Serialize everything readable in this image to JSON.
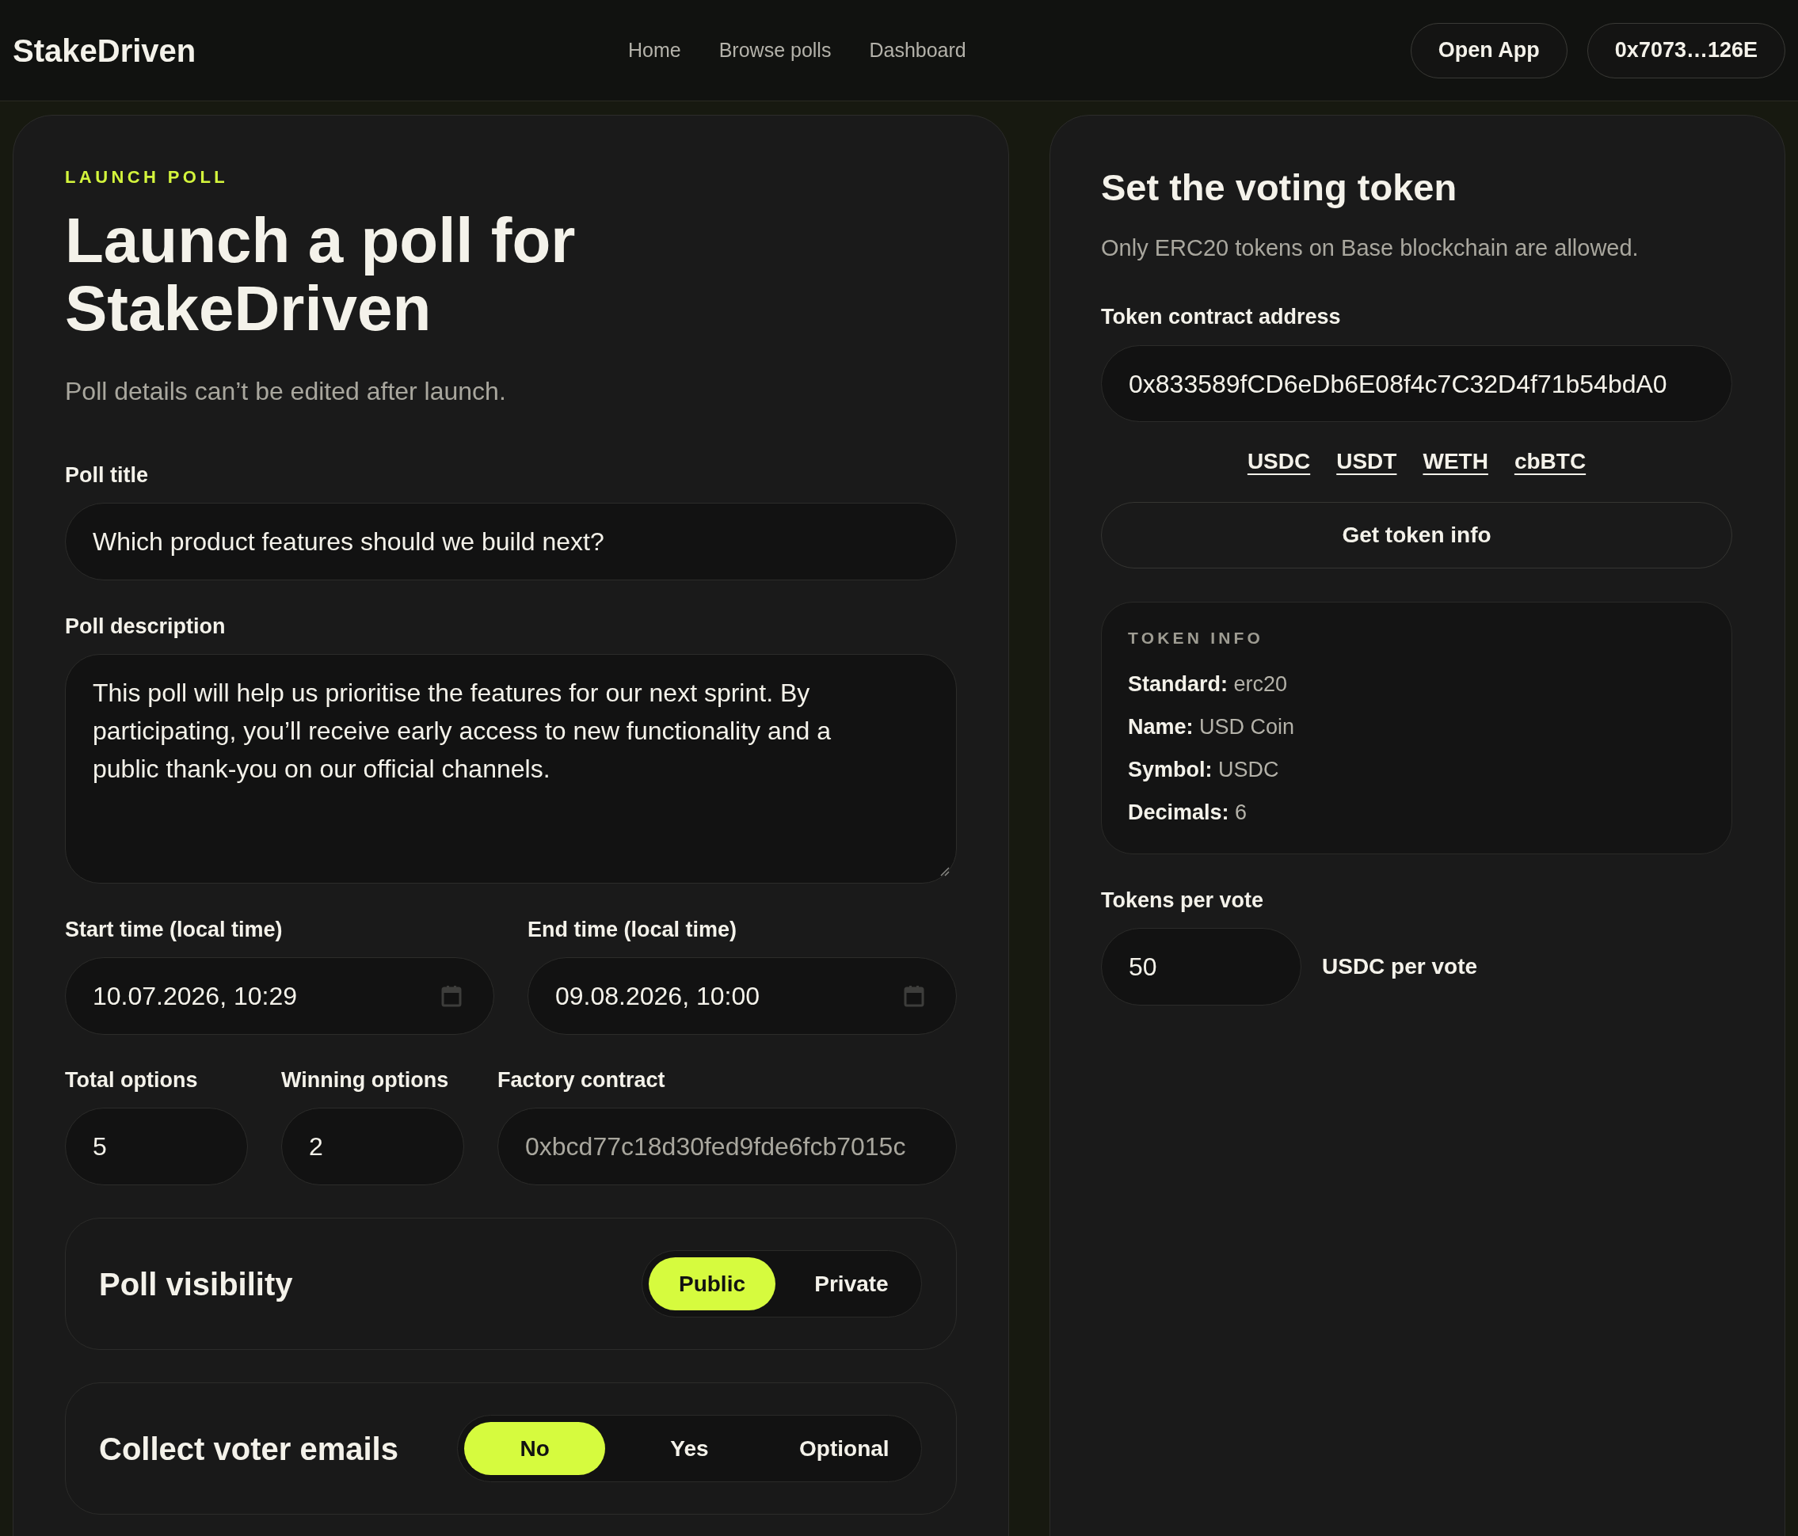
{
  "header": {
    "logo": "StakeDriven",
    "nav": [
      {
        "label": "Home"
      },
      {
        "label": "Browse polls"
      },
      {
        "label": "Dashboard"
      }
    ],
    "actions": [
      {
        "label": "Open App"
      },
      {
        "label": "0x7073…126E"
      }
    ]
  },
  "launch_form": {
    "eyebrow": "LAUNCH POLL",
    "title": "Launch a poll for StakeDriven",
    "subtitle": "Poll details can’t be edited after launch.",
    "poll_title": {
      "label": "Poll title",
      "value": "Which product features should we build next?"
    },
    "poll_description": {
      "label": "Poll description",
      "value": "This poll will help us prioritise the features for our next sprint. By participating, you’ll receive early access to new functionality and a public thank-you on our official channels."
    },
    "times": [
      {
        "label": "Start time (local time)",
        "value": "10.07.2026, 10:29"
      },
      {
        "label": "End time (local time)",
        "value": "09.08.2026, 10:00"
      }
    ],
    "numbers": [
      {
        "label": "Total options",
        "value": "5",
        "disabled": false
      },
      {
        "label": "Winning options",
        "value": "2",
        "disabled": false
      },
      {
        "label": "Factory contract",
        "value": "0xbcd77c18d30fed9fde6fcb7015c",
        "disabled": true
      }
    ],
    "choices": [
      {
        "title": "Poll visibility",
        "options": [
          {
            "label": "Public",
            "selected": true
          },
          {
            "label": "Private",
            "selected": false
          }
        ]
      },
      {
        "title": "Collect voter emails",
        "options": [
          {
            "label": "No",
            "selected": true
          },
          {
            "label": "Yes",
            "selected": false
          },
          {
            "label": "Optional",
            "selected": false
          }
        ]
      }
    ]
  },
  "token_panel": {
    "title": "Set the voting token",
    "subtitle": "Only ERC20 tokens on Base blockchain are allowed.",
    "address": {
      "label": "Token contract address",
      "value": "0x833589fCD6eDb6E08f4c7C32D4f71b54bdA0"
    },
    "presets": [
      {
        "label": "USDC"
      },
      {
        "label": "USDT"
      },
      {
        "label": "WETH"
      },
      {
        "label": "cbBTC"
      }
    ],
    "button": "Get token info",
    "info": {
      "heading": "TOKEN INFO",
      "rows": [
        {
          "label": "Standard:",
          "value": "erc20"
        },
        {
          "label": "Name:",
          "value": "USD Coin"
        },
        {
          "label": "Symbol:",
          "value": "USDC"
        },
        {
          "label": "Decimals:",
          "value": "6"
        }
      ]
    },
    "tokens_per_vote": {
      "label": "Tokens per vote",
      "value": "50",
      "unit": "USDC per vote"
    }
  }
}
